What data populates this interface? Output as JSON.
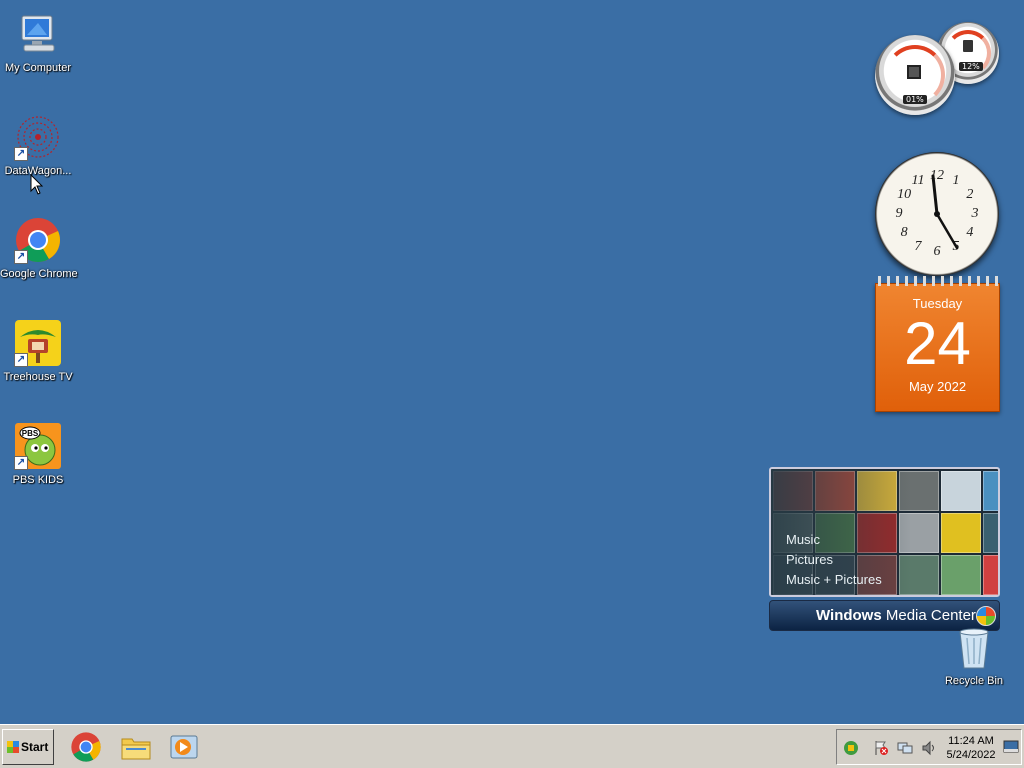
{
  "desktop": {
    "icons": [
      {
        "label": "My Computer"
      },
      {
        "label": "DataWagon..."
      },
      {
        "label": "Google Chrome"
      },
      {
        "label": "Treehouse TV"
      },
      {
        "label": "PBS KIDS"
      }
    ],
    "recycle_bin": {
      "label": "Recycle Bin"
    }
  },
  "gadgets": {
    "cpu_meter": {
      "cpu": "01%",
      "memory": "12%"
    },
    "clock": {
      "numbers": [
        "12",
        "1",
        "2",
        "3",
        "4",
        "5",
        "6",
        "7",
        "8",
        "9",
        "10",
        "11"
      ]
    },
    "calendar": {
      "weekday": "Tuesday",
      "day": "24",
      "month_year": "May 2022"
    },
    "media_center": {
      "items": [
        "Music",
        "Pictures",
        "Music + Pictures"
      ],
      "brand_bold": "Windows",
      "brand_rest": " Media Center"
    }
  },
  "taskbar": {
    "start_label": "Start",
    "pinned": [
      {
        "icon": "chrome-icon"
      },
      {
        "icon": "file-explorer-icon"
      },
      {
        "icon": "media-player-icon"
      }
    ],
    "tray": {
      "time": "11:24 AM",
      "date": "5/24/2022"
    }
  },
  "colors": {
    "desktop_bg": "#3a6ea5",
    "taskbar_bg": "#d4d0c8",
    "calendar_orange": "#e8700f"
  }
}
